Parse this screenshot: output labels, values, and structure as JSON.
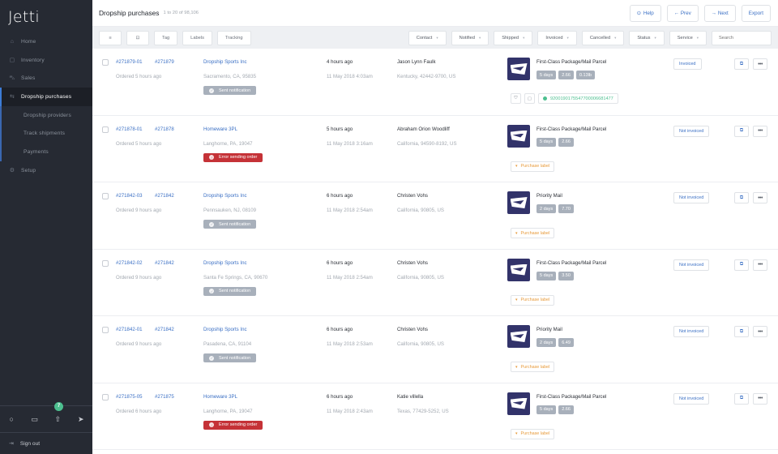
{
  "app": {
    "logo": "Jetti"
  },
  "sidebar": {
    "items": [
      {
        "label": "Home",
        "icon": "house-icon"
      },
      {
        "label": "Inventory",
        "icon": "box-icon"
      },
      {
        "label": "Sales",
        "icon": "cart-icon"
      },
      {
        "label": "Dropship purchases",
        "icon": "truck-icon",
        "active": true
      },
      {
        "label": "Dropship providers"
      },
      {
        "label": "Track shipments"
      },
      {
        "label": "Payments"
      },
      {
        "label": "Setup",
        "icon": "gear-icon"
      }
    ],
    "bottom_badge": "7",
    "signout": "Sign out"
  },
  "header": {
    "title": "Dropship purchases",
    "range": "1 to 20 of 98,106",
    "help": "Help",
    "prev": "← Prev",
    "next": "→ Next",
    "export": "Export"
  },
  "filters": {
    "tag": "Tag",
    "labels": "Labels",
    "tracking": "Tracking",
    "contact": "Contact",
    "notified": "Notified",
    "shipped": "Shipped",
    "invoiced": "Invoiced",
    "cancelled": "Cancelled",
    "status": "Status",
    "service": "Service",
    "search_placeholder": "Search"
  },
  "colors": {
    "accent": "#3a6fc4",
    "error": "#c53237",
    "success": "#4cbf8f",
    "sidebar": "#262a33",
    "warning": "#e79a3a"
  },
  "rows": [
    {
      "order": "#271879-01",
      "parent": "#271879",
      "ordered": "Ordered 5 hours ago",
      "vendor": "Dropship Sports Inc",
      "location": "Sacramento, CA, 95835",
      "notification": "Sent notification",
      "ago": "4 hours ago",
      "date": "11 May 2018 4:03am",
      "customer": "Jason Lynn Faulk",
      "address": "Kentucky, 42442-9700, US",
      "service": "First-Class Package/Mail Parcel",
      "chips": [
        "5 days",
        "2.66",
        "0.13lb"
      ],
      "tracking": "9200190175547700006681477",
      "purchase_label": "",
      "invoice": "Invoiced"
    },
    {
      "order": "#271878-01",
      "parent": "#271878",
      "ordered": "Ordered 5 hours ago",
      "vendor": "Homeware 3PL",
      "location": "Langhorne, PA, 19047",
      "notification": "Error sending order",
      "ago": "5 hours ago",
      "date": "11 May 2018 3:16am",
      "customer": "Abraham Orion Woodliff",
      "address": "California, 94590-8192, US",
      "service": "First-Class Package/Mail Parcel",
      "chips": [
        "5 days",
        "2.66"
      ],
      "tracking": "",
      "purchase_label": "Purchase label",
      "invoice": "Not invoiced"
    },
    {
      "order": "#271842-03",
      "parent": "#271842",
      "ordered": "Ordered 9 hours ago",
      "vendor": "Dropship Sports Inc",
      "location": "Pennsauken, NJ, 08109",
      "notification": "Sent notification",
      "ago": "6 hours ago",
      "date": "11 May 2018 2:54am",
      "customer": "Christen Vohs",
      "address": "California, 90805, US",
      "service": "Priority Mail",
      "chips": [
        "2 days",
        "7.70"
      ],
      "tracking": "",
      "purchase_label": "Purchase label",
      "invoice": "Not invoiced"
    },
    {
      "order": "#271842-02",
      "parent": "#271842",
      "ordered": "Ordered 9 hours ago",
      "vendor": "Dropship Sports Inc",
      "location": "Santa Fe Springs, CA, 90670",
      "notification": "Sent notification",
      "ago": "6 hours ago",
      "date": "11 May 2018 2:54am",
      "customer": "Christen Vohs",
      "address": "California, 90805, US",
      "service": "First-Class Package/Mail Parcel",
      "chips": [
        "5 days",
        "3.50"
      ],
      "tracking": "",
      "purchase_label": "Purchase label",
      "invoice": "Not invoiced"
    },
    {
      "order": "#271842-01",
      "parent": "#271842",
      "ordered": "Ordered 9 hours ago",
      "vendor": "Dropship Sports Inc",
      "location": "Pasadena, CA, 91104",
      "notification": "Sent notification",
      "ago": "6 hours ago",
      "date": "11 May 2018 2:53am",
      "customer": "Christen Vohs",
      "address": "California, 90805, US",
      "service": "Priority Mail",
      "chips": [
        "2 days",
        "6.49"
      ],
      "tracking": "",
      "purchase_label": "Purchase label",
      "invoice": "Not invoiced"
    },
    {
      "order": "#271875-05",
      "parent": "#271875",
      "ordered": "Ordered 6 hours ago",
      "vendor": "Homeware 3PL",
      "location": "Langhorne, PA, 19047",
      "notification": "Error sending order",
      "ago": "6 hours ago",
      "date": "11 May 2018 2:43am",
      "customer": "Katie villella",
      "address": "Texas, 77429-5252, US",
      "service": "First-Class Package/Mail Parcel",
      "chips": [
        "5 days",
        "2.66"
      ],
      "tracking": "",
      "purchase_label": "Purchase label",
      "invoice": "Not invoiced"
    }
  ]
}
